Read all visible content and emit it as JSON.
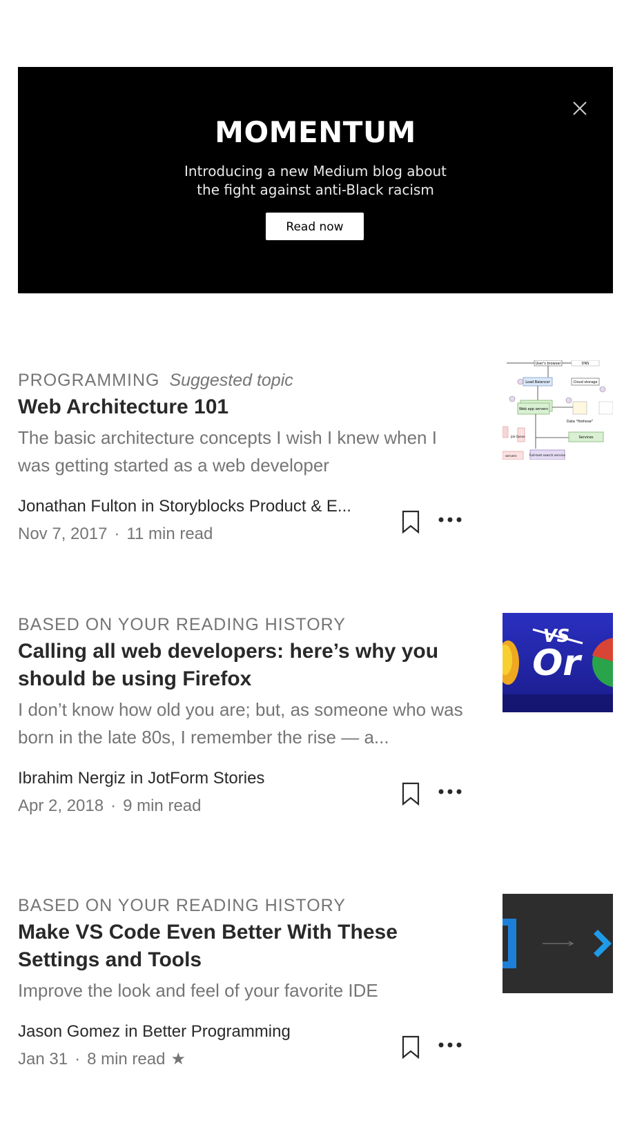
{
  "banner": {
    "title": "MOMENTUM",
    "subtitle_line1": "Introducing a new Medium blog about",
    "subtitle_line2": "the fight against anti-Black racism",
    "button": "Read now",
    "close_icon": "close-icon"
  },
  "articles": [
    {
      "kicker": "PROGRAMMING",
      "topic_note": "Suggested topic",
      "headline": "Web Architecture 101",
      "description": "The basic architecture concepts I wish I knew when I was getting started as a web developer",
      "author": "Jonathan Fulton in Storyblocks Product & E...",
      "date": "Nov 7, 2017",
      "read_time": "11 min read",
      "thumbnail": "architecture-diagram"
    },
    {
      "kicker": "BASED ON YOUR READING HISTORY",
      "headline": "Calling all web developers: here’s why you should be using Firefox",
      "description": "I don’t know how old you are; but, as someone who was born in the late 80s, I remember the rise — a...",
      "author": "Ibrahim Nergiz in JotForm Stories",
      "date": "Apr 2, 2018",
      "read_time": "9 min read",
      "thumbnail": "vs-or-browsers"
    },
    {
      "kicker": "BASED ON YOUR READING HISTORY",
      "headline": "Make VS Code Even Better With These Settings and Tools",
      "description": "Improve the look and feel of your favorite IDE",
      "author": "Jason Gomez in Better Programming",
      "date": "Jan 31",
      "read_time": "8 min read",
      "member_star": "★",
      "thumbnail": "vscode-logo"
    }
  ],
  "colors": {
    "banner_bg": "#000000",
    "text_primary": "#292929",
    "text_muted": "#757575"
  },
  "thumb_texts": {
    "t1_browser": "User's browser",
    "t1_dns": "DNS",
    "t1_lb": "Load Balancer",
    "t1_cloud": "Cloud storage",
    "t1_web": "Web app servers",
    "t1_data": "Data \"firehose\"",
    "t1_services": "Services",
    "t1_job": "Job Queue",
    "t1_search": "Full-text search service",
    "t1_servers": "servers",
    "t2_vs": "VS",
    "t2_or": "Or"
  }
}
